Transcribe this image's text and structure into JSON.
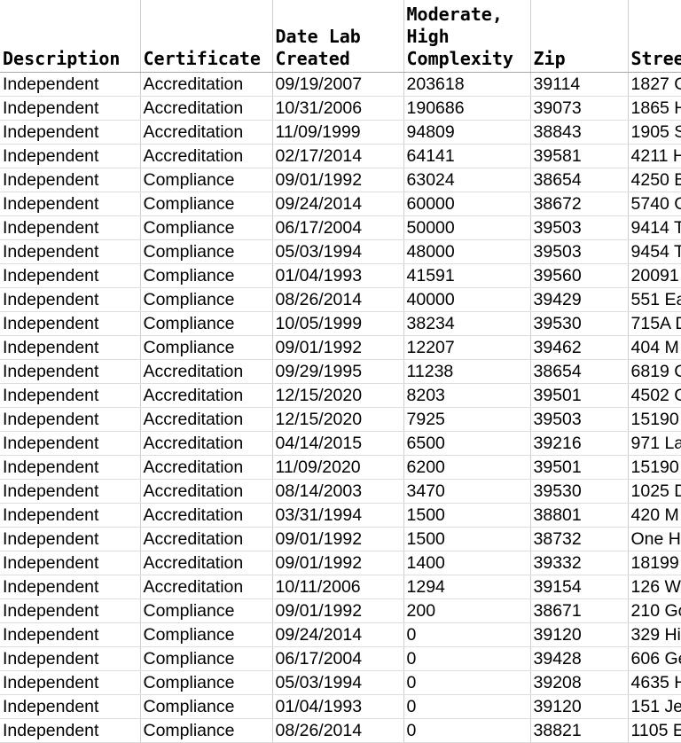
{
  "columns": [
    "Description",
    "Certificate",
    "Date Lab\nCreated",
    "Moderate,\nHigh\nComplexity",
    "Zip",
    "Street"
  ],
  "rows": [
    [
      "Independent",
      "Accreditation",
      "09/19/2007",
      "203618",
      "39114",
      "1827 C"
    ],
    [
      "Independent",
      "Accreditation",
      "10/31/2006",
      "190686",
      "39073",
      "1865 H"
    ],
    [
      "Independent",
      "Accreditation",
      "11/09/1999",
      "94809",
      "38843",
      "1905 S"
    ],
    [
      "Independent",
      "Accreditation",
      "02/17/2014",
      "64141",
      "39581",
      "4211 H"
    ],
    [
      "Independent",
      "Compliance",
      "09/01/1992",
      "63024",
      "38654",
      "4250 B"
    ],
    [
      "Independent",
      "Compliance",
      "09/24/2014",
      "60000",
      "38672",
      "5740 G"
    ],
    [
      "Independent",
      "Compliance",
      "06/17/2004",
      "50000",
      "39503",
      "9414 T"
    ],
    [
      "Independent",
      "Compliance",
      "05/03/1994",
      "48000",
      "39503",
      "9454 T"
    ],
    [
      "Independent",
      "Compliance",
      "01/04/1993",
      "41591",
      "39560",
      "20091"
    ],
    [
      "Independent",
      "Compliance",
      "08/26/2014",
      "40000",
      "39429",
      "551 Ea"
    ],
    [
      "Independent",
      "Compliance",
      "10/05/1999",
      "38234",
      "39530",
      "715A D"
    ],
    [
      "Independent",
      "Compliance",
      "09/01/1992",
      "12207",
      "39462",
      "404 M"
    ],
    [
      "Independent",
      "Accreditation",
      "09/29/1995",
      "11238",
      "38654",
      "6819 C"
    ],
    [
      "Independent",
      "Accreditation",
      "12/15/2020",
      "8203",
      "39501",
      "4502 C"
    ],
    [
      "Independent",
      "Accreditation",
      "12/15/2020",
      "7925",
      "39503",
      "15190"
    ],
    [
      "Independent",
      "Accreditation",
      "04/14/2015",
      "6500",
      "39216",
      "971 La"
    ],
    [
      "Independent",
      "Accreditation",
      "11/09/2020",
      "6200",
      "39501",
      "15190"
    ],
    [
      "Independent",
      "Accreditation",
      "08/14/2003",
      "3470",
      "39530",
      "1025 D"
    ],
    [
      "Independent",
      "Accreditation",
      "03/31/1994",
      "1500",
      "38801",
      "420 M"
    ],
    [
      "Independent",
      "Accreditation",
      "09/01/1992",
      "1500",
      "38732",
      "One H"
    ],
    [
      "Independent",
      "Accreditation",
      "09/01/1992",
      "1400",
      "39332",
      "18199"
    ],
    [
      "Independent",
      "Accreditation",
      "10/11/2006",
      "1294",
      "39154",
      "126 W"
    ],
    [
      "Independent",
      "Compliance",
      "09/01/1992",
      "200",
      "38671",
      "210 Go"
    ],
    [
      "Independent",
      "Compliance",
      "09/24/2014",
      "0",
      "39120",
      "329 Hi"
    ],
    [
      "Independent",
      "Compliance",
      "06/17/2004",
      "0",
      "39428",
      "606 Ge"
    ],
    [
      "Independent",
      "Compliance",
      "05/03/1994",
      "0",
      "39208",
      "4635 H"
    ],
    [
      "Independent",
      "Compliance",
      "01/04/1993",
      "0",
      "39120",
      "151 Jef"
    ],
    [
      "Independent",
      "Compliance",
      "08/26/2014",
      "0",
      "38821",
      "1105 E"
    ]
  ]
}
